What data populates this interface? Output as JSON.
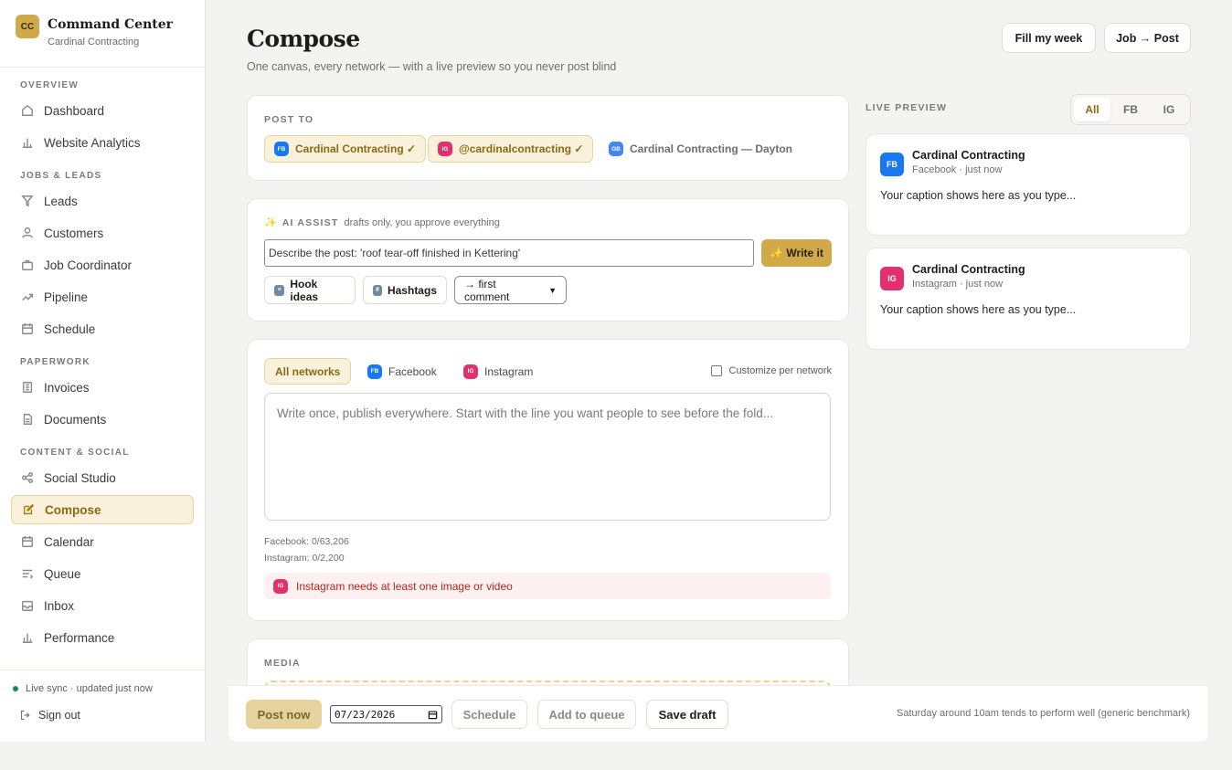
{
  "brand": {
    "initials": "CC",
    "title": "Command Center",
    "subtitle": "Cardinal Contracting"
  },
  "nav": {
    "overview_label": "OVERVIEW",
    "overview": [
      "Dashboard",
      "Website Analytics"
    ],
    "jobs_label": "JOBS & LEADS",
    "jobs": [
      "Leads",
      "Customers",
      "Job Coordinator",
      "Pipeline",
      "Schedule"
    ],
    "paperwork_label": "PAPERWORK",
    "paperwork": [
      "Invoices",
      "Documents"
    ],
    "content_label": "CONTENT & SOCIAL",
    "content": [
      "Social Studio",
      "Compose",
      "Calendar",
      "Queue",
      "Inbox",
      "Performance"
    ],
    "active": "Compose"
  },
  "footer": {
    "sync": "Live sync · updated just now",
    "signout": "Sign out"
  },
  "page": {
    "title": "Compose",
    "subtitle": "One canvas, every network — with a live preview so you never post blind"
  },
  "top_buttons": {
    "fill_week": "Fill my week",
    "job_post": "Job → Post"
  },
  "post_to": {
    "label": "POST TO",
    "accounts": [
      {
        "badge": "FB",
        "name": "Cardinal Contracting ✓",
        "selected": true
      },
      {
        "badge": "IG",
        "name": "@cardinalcontracting ✓",
        "selected": true
      },
      {
        "badge": "GB",
        "name": "Cardinal Contracting — Dayton",
        "selected": false
      }
    ]
  },
  "ai": {
    "icon": "✨",
    "label": "AI ASSIST",
    "note": "drafts only, you approve everything",
    "input_value": "Describe the post: 'roof tear-off finished in Kettering'",
    "write_button": "✨ Write it",
    "hook_ideas": "Hook ideas",
    "hashtags": "Hashtags",
    "comment_select": "→ first comment"
  },
  "editor": {
    "tabs": [
      "All networks",
      "Facebook",
      "Instagram"
    ],
    "customize_label": "Customize per network",
    "placeholder": "Write once, publish everywhere. Start with the line you want people to see before the fold...",
    "fb_counter": "Facebook: 0/63,206",
    "ig_counter": "Instagram: 0/2,200",
    "warning": "Instagram needs at least one image or video"
  },
  "media": {
    "label": "MEDIA"
  },
  "preview": {
    "label": "LIVE PREVIEW",
    "tabs": [
      "All",
      "FB",
      "IG"
    ],
    "cards": [
      {
        "badge": "FB",
        "name": "Cardinal Contracting",
        "meta": "Facebook · just now",
        "caption": "Your caption shows here as you type..."
      },
      {
        "badge": "IG",
        "name": "Cardinal Contracting",
        "meta": "Instagram · just now",
        "caption": "Your caption shows here as you type..."
      }
    ]
  },
  "actions": {
    "post_now": "Post now",
    "date_month": "07",
    "date_day": "23",
    "date_year": "2026",
    "schedule": "Schedule",
    "queue": "Add to queue",
    "save": "Save draft",
    "benchmark": "Saturday around 10am tends to perform well (generic benchmark)"
  },
  "colors": {
    "accent": "#cfa94a",
    "active_bg": "#faf1dc",
    "facebook": "#1877f2",
    "instagram": "#e1306c",
    "warning": "#b3261e"
  }
}
